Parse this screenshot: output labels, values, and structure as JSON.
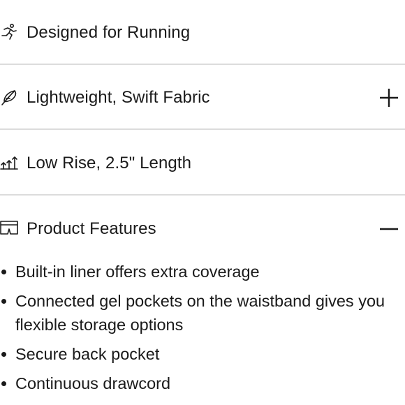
{
  "accordion": [
    {
      "label": "Designed for Running",
      "icon": "runner-icon",
      "toggle": "none"
    },
    {
      "label": "Lightweight, Swift Fabric",
      "icon": "feather-icon",
      "toggle": "plus"
    },
    {
      "label": "Low Rise, 2.5\" Length",
      "icon": "length-arrows-icon",
      "toggle": "none"
    },
    {
      "label": "Product Features",
      "icon": "shorts-icon",
      "toggle": "minus"
    }
  ],
  "features": [
    "Built-in liner offers extra coverage",
    "Connected gel pockets on the waistband gives you flexible storage options",
    "Secure back pocket",
    "Continuous drawcord"
  ]
}
